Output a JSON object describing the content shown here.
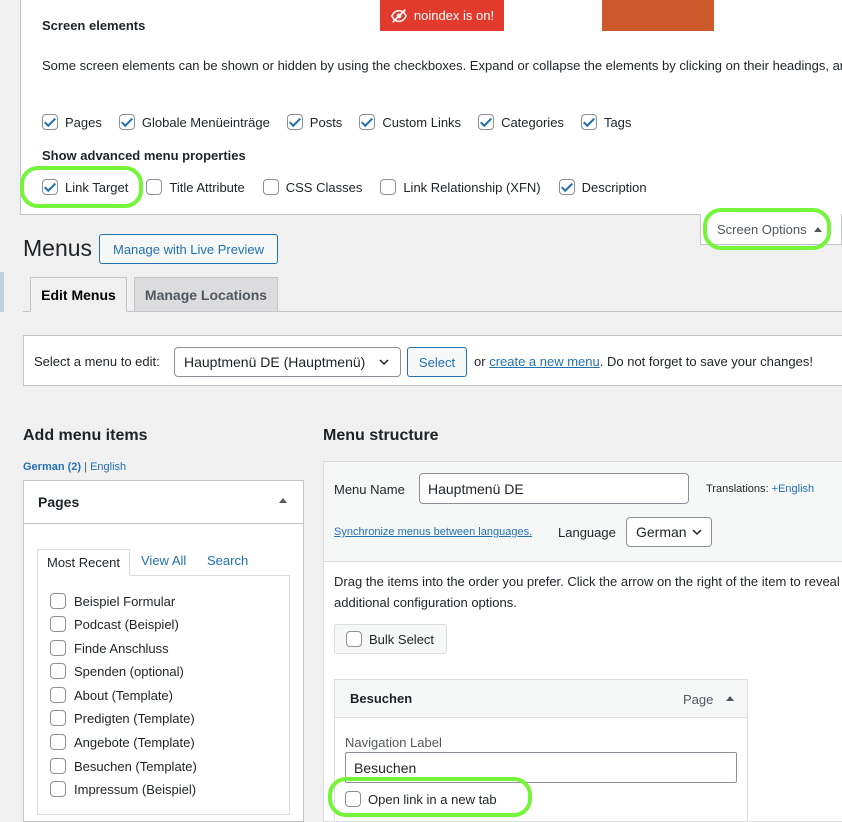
{
  "screen_options": {
    "title": "Screen elements",
    "description": "Some screen elements can be shown or hidden by using the checkboxes. Expand or collapse the elements by clicking on their headings, and arrange them by dragging their headings or by clicking on the up and down arrows.",
    "noindex_badge": "noindex is on!",
    "boxes": [
      {
        "label": "Pages",
        "checked": true
      },
      {
        "label": "Globale Menüeinträge",
        "checked": true
      },
      {
        "label": "Posts",
        "checked": true
      },
      {
        "label": "Custom Links",
        "checked": true
      },
      {
        "label": "Categories",
        "checked": true
      },
      {
        "label": "Tags",
        "checked": true
      }
    ],
    "advanced_title": "Show advanced menu properties",
    "advanced": [
      {
        "label": "Link Target",
        "checked": true
      },
      {
        "label": "Title Attribute",
        "checked": false
      },
      {
        "label": "CSS Classes",
        "checked": false
      },
      {
        "label": "Link Relationship (XFN)",
        "checked": false
      },
      {
        "label": "Description",
        "checked": true
      }
    ],
    "tab_label": "Screen Options"
  },
  "header": {
    "title": "Menus",
    "live_preview": "Manage with Live Preview",
    "tabs": [
      {
        "label": "Edit Menus",
        "active": true
      },
      {
        "label": "Manage Locations",
        "active": false
      }
    ]
  },
  "select_bar": {
    "label": "Select a menu to edit:",
    "selected": "Hauptmenü DE (Hauptmenü)",
    "button": "Select",
    "or": "or",
    "create_link": "create a new menu",
    "tail": ". Do not forget to save your changes!"
  },
  "add_items": {
    "title": "Add menu items",
    "lang_current": "German (2)",
    "lang_sep": "|",
    "lang_other": "English",
    "pages_title": "Pages",
    "subtabs": [
      "Most Recent",
      "View All",
      "Search"
    ],
    "pages": [
      "Beispiel Formular",
      "Podcast (Beispiel)",
      "Finde Anschluss",
      "Spenden (optional)",
      "About (Template)",
      "Predigten (Template)",
      "Angebote (Template)",
      "Besuchen (Template)",
      "Impressum (Beispiel)"
    ]
  },
  "structure": {
    "title": "Menu structure",
    "menu_name_label": "Menu Name",
    "menu_name_value": "Hauptmenü DE",
    "translations_label": "Translations:",
    "translations_link": "English",
    "sync_link": "Synchronize menus between languages.",
    "language_label": "Language",
    "language_value": "German",
    "drag_text_1": "Drag the items into the order you prefer. Click the arrow on the right of the item to reveal",
    "drag_text_2": "additional configuration options.",
    "bulk_select": "Bulk Select",
    "item": {
      "title": "Besuchen",
      "type": "Page",
      "nav_label": "Navigation Label",
      "nav_value": "Besuchen",
      "new_tab": "Open link in a new tab"
    }
  },
  "colors": {
    "accent": "#2271b1",
    "highlight_ring": "#75f53a",
    "badge": "#e23b2d"
  }
}
